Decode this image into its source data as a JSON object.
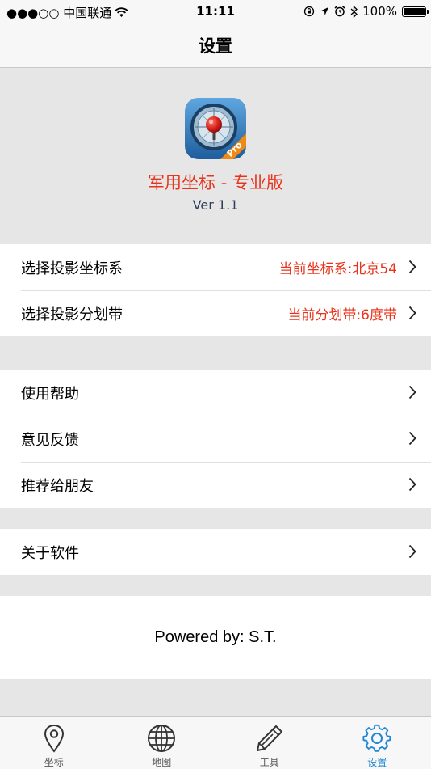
{
  "status_bar": {
    "carrier": "●●●○○ 中国联通",
    "time": "11:11",
    "battery": "100%"
  },
  "nav": {
    "title": "设置"
  },
  "app": {
    "name": "军用坐标 - 专业版",
    "version": "Ver 1.1",
    "icon_badge": "Pro"
  },
  "settings": {
    "projection_system": {
      "label": "选择投影坐标系",
      "value": "当前坐标系:北京54"
    },
    "projection_zone": {
      "label": "选择投影分划带",
      "value": "当前分划带:6度带"
    },
    "help": {
      "label": "使用帮助"
    },
    "feedback": {
      "label": "意见反馈"
    },
    "recommend": {
      "label": "推荐给朋友"
    },
    "about": {
      "label": "关于软件"
    }
  },
  "footer": {
    "powered_by": "Powered by: S.T."
  },
  "tabbar": {
    "tabs": [
      {
        "label": "坐标",
        "icon": "location-pin-icon"
      },
      {
        "label": "地图",
        "icon": "globe-icon"
      },
      {
        "label": "工具",
        "icon": "pencil-icon"
      },
      {
        "label": "设置",
        "icon": "gear-icon"
      }
    ],
    "active_index": 3
  },
  "colors": {
    "accent_red": "#e8341c",
    "tab_active": "#1e88d6",
    "version_text": "#2c3e59"
  }
}
